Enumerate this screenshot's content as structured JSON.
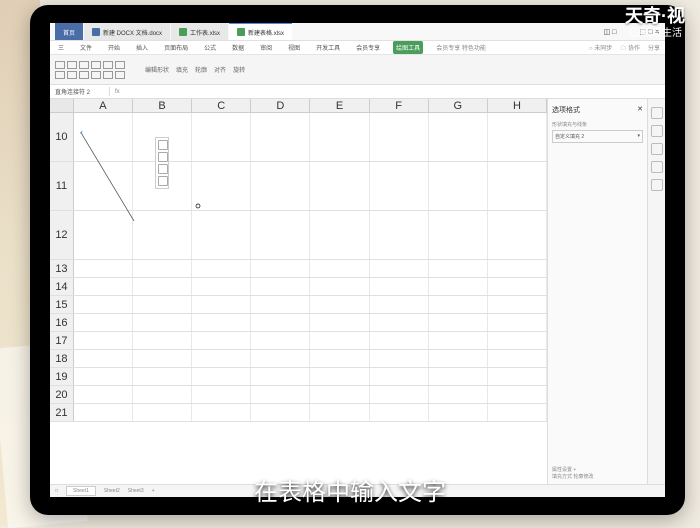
{
  "watermark": {
    "top": "天奇·视",
    "sub": "天奇生活"
  },
  "caption": "在表格中输入文字",
  "tabs": {
    "home": "首页",
    "doc1": "新建 DOCX 文档.docx",
    "doc2": "工作表.xlsx",
    "doc3": "新建表格.xlsx"
  },
  "winctrl": {
    "icons": "⬚ □ ✕",
    "left": "◫ □"
  },
  "ribbon": {
    "items": [
      "三",
      "文件",
      "开始",
      "插入",
      "页面布局",
      "公式",
      "数据",
      "审阅",
      "视图",
      "开发工具",
      "会员专享"
    ],
    "active": "绘图工具",
    "extra": "会员专享  特色功能",
    "right1": "○ 未同步",
    "right2": "☁ 协作",
    "right3": "分享"
  },
  "toolbar": {
    "t1": "编辑形状",
    "t2": "填充",
    "t3": "轮廓",
    "t4": "对齐",
    "t5": "旋转"
  },
  "formula": {
    "name": "直角连接符 2",
    "fx": "fx"
  },
  "columns": [
    "A",
    "B",
    "C",
    "D",
    "E",
    "F",
    "G",
    "H"
  ],
  "rows_tall": [
    "10",
    "11",
    "12"
  ],
  "rows_short": [
    "13",
    "14",
    "15",
    "16",
    "17",
    "18",
    "19",
    "20",
    "21"
  ],
  "panel": {
    "title": "选项格式",
    "sub": "形状填充与线条",
    "select": "自定义填充 2",
    "footer1": "属性设置  +",
    "footer2": "填充方式   轮廓修改"
  },
  "status": {
    "s1": "□",
    "s2": "Sheet1",
    "s3": "Sheet2",
    "s4": "Sheet3",
    "s5": "+"
  }
}
